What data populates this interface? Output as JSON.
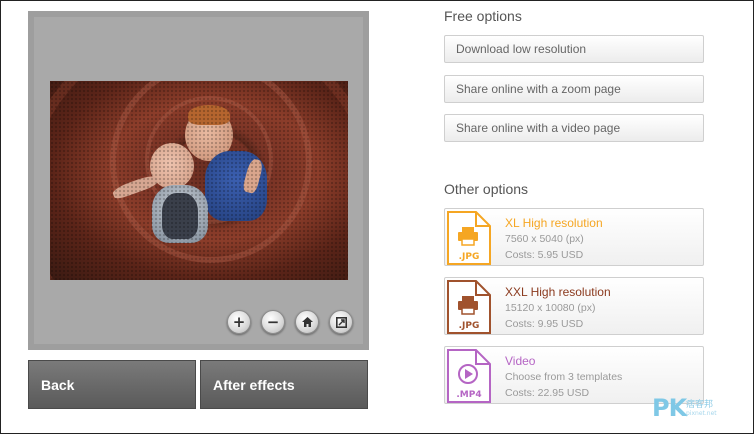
{
  "preview": {
    "zoom_controls": [
      {
        "name": "zoom-in-button",
        "glyph": "+",
        "icon": "plus-icon"
      },
      {
        "name": "zoom-out-button",
        "glyph": "−",
        "icon": "minus-icon"
      },
      {
        "name": "zoom-reset-button",
        "glyph": "",
        "icon": "home-icon"
      },
      {
        "name": "fullscreen-button",
        "glyph": "",
        "icon": "fullscreen-icon"
      }
    ]
  },
  "nav": {
    "back_label": "Back",
    "after_effects_label": "After effects"
  },
  "free_options": {
    "title": "Free options",
    "buttons": [
      "Download low resolution",
      "Share online with a zoom page",
      "Share online with a video page"
    ]
  },
  "other_options": {
    "title": "Other options",
    "items": [
      {
        "title": "XL High resolution",
        "line1": "7560 x 5040 (px)",
        "line2": "Costs: 5.95 USD",
        "badge": ".JPG",
        "icon": "printer-icon",
        "color": "#f5a623"
      },
      {
        "title": "XXL High resolution",
        "line1": "15120 x 10080 (px)",
        "line2": "Costs: 9.95 USD",
        "badge": ".JPG",
        "icon": "printer-icon",
        "color": "#a0522d"
      },
      {
        "title": "Video",
        "line1": "Choose from 3 templates",
        "line2": "Costs: 22.95 USD",
        "badge": ".MP4",
        "icon": "play-icon",
        "color": "#b565c4"
      }
    ]
  },
  "watermark": {
    "logo": "PK",
    "text": "痞客邦",
    "sub": "pixnet.net"
  }
}
